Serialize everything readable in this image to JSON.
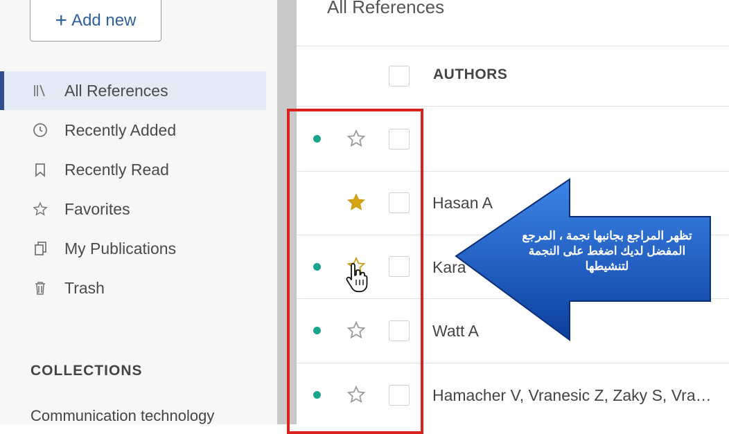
{
  "sidebar": {
    "add_new_label": "Add new",
    "items": [
      {
        "label": "All References",
        "icon": "library-icon",
        "active": true
      },
      {
        "label": "Recently Added",
        "icon": "clock-icon",
        "active": false
      },
      {
        "label": "Recently Read",
        "icon": "bookmark-icon",
        "active": false
      },
      {
        "label": "Favorites",
        "icon": "star-icon",
        "active": false
      },
      {
        "label": "My Publications",
        "icon": "publications-icon",
        "active": false
      },
      {
        "label": "Trash",
        "icon": "trash-icon",
        "active": false
      }
    ],
    "collections_title": "COLLECTIONS",
    "collections": [
      "Communication technology"
    ]
  },
  "main": {
    "title": "All References",
    "column_header": "AUTHORS",
    "rows": [
      {
        "author": "",
        "unread": true,
        "favorite": false
      },
      {
        "author": "Hasan A",
        "unread": false,
        "favorite": true
      },
      {
        "author": "Kara",
        "unread": true,
        "favorite": false
      },
      {
        "author": "Watt A",
        "unread": true,
        "favorite": false
      },
      {
        "author": "Hamacher V, Vranesic Z, Zaky S, Vra…",
        "unread": true,
        "favorite": false
      }
    ]
  },
  "callout": {
    "text": "تظهر المراجع بجانبها نجمة ، المرجع المفضل لديك اضغط على النجمة لتنشيطها"
  },
  "colors": {
    "accent": "#2d4e88",
    "unread_dot": "#1aa38d",
    "favorite_star": "#d4a514",
    "highlight_border": "#d9211d",
    "callout_fill": "#1f5fc8"
  }
}
